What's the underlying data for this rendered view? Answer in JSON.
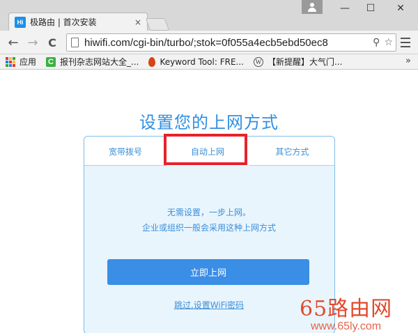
{
  "browser": {
    "tab_title": "极路由 | 首次安装",
    "tab_favicon_text": "Hi",
    "tab_close": "×",
    "url": "hiwifi.com/cgi-bin/turbo/;stok=0f055a4ecb5ebd50ec8",
    "window_buttons": {
      "minimize": "—",
      "maximize": "☐",
      "close": "✕"
    },
    "nav": {
      "back": "←",
      "forward": "→",
      "reload": "C"
    },
    "omnibox_actions": {
      "search": "⚲",
      "star": "☆"
    },
    "bookmarks": [
      {
        "label": "应用",
        "icon": "apps-grid-icon"
      },
      {
        "label": "报刊杂志网站大全_...",
        "icon": "c-site-icon"
      },
      {
        "label": "Keyword Tool: FRE...",
        "icon": "flame-icon"
      },
      {
        "label": "【新提醒】大气门...",
        "icon": "wordpress-icon"
      }
    ],
    "bookmarks_more": "»"
  },
  "page": {
    "heading": "设置您的上网方式",
    "tabs": [
      "宽带拨号",
      "自动上网",
      "其它方式"
    ],
    "active_tab": 1,
    "description_line1": "无需设置，一步上网。",
    "description_line2": "企业或组织一般会采用这种上网方式",
    "primary_button": "立即上网",
    "skip_link": "跳过,设置WiFi密码"
  },
  "watermark": {
    "title": "65路由网",
    "url": "www.65ly.com"
  },
  "colors": {
    "accent": "#3b8ee6",
    "heading": "#2f8fe3",
    "highlight": "#e6232b",
    "panel_bg": "#e9f5fd",
    "watermark": "#e04a2c"
  }
}
